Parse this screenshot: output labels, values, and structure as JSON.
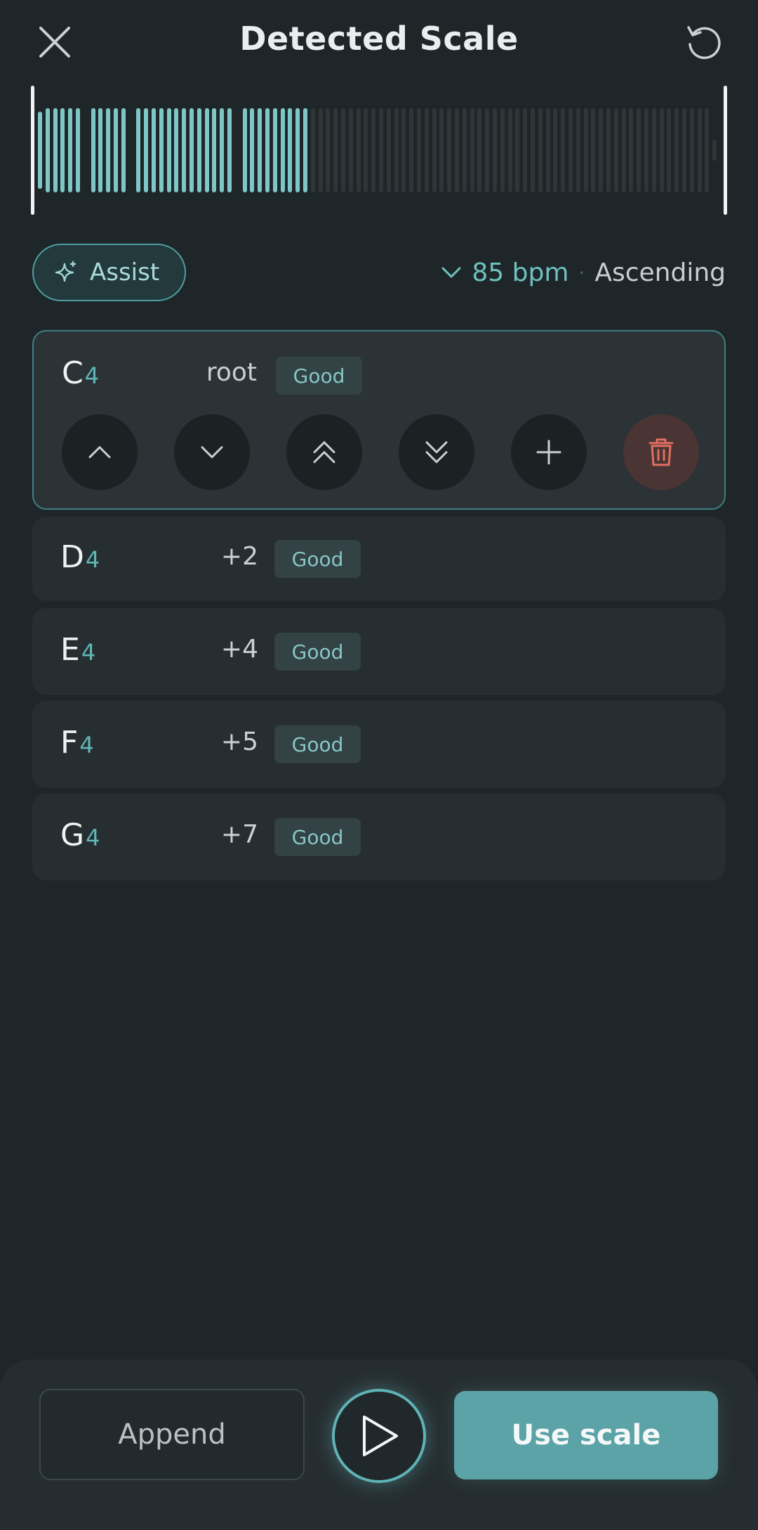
{
  "header": {
    "title": "Detected Scale",
    "close_icon": "close-icon",
    "reset_icon": "undo-icon"
  },
  "waveform": {
    "played_color": "#7fc7c7",
    "unplayed_color": "#2e3638",
    "playhead_progress": 0.4
  },
  "assist": {
    "label": "Assist",
    "icon": "sparkle-icon"
  },
  "tempo": {
    "value": "85 bpm",
    "separator": "·",
    "direction": "Ascending",
    "icon": "chevron-down-icon"
  },
  "notes": [
    {
      "name": "C",
      "octave": "4",
      "interval": "root",
      "quality": "Good"
    },
    {
      "name": "D",
      "octave": "4",
      "interval": "+2",
      "quality": "Good"
    },
    {
      "name": "E",
      "octave": "4",
      "interval": "+4",
      "quality": "Good"
    },
    {
      "name": "F",
      "octave": "4",
      "interval": "+5",
      "quality": "Good"
    },
    {
      "name": "G",
      "octave": "4",
      "interval": "+7",
      "quality": "Good"
    }
  ],
  "controls": [
    "chevron-up-icon",
    "chevron-down-icon",
    "double-chevron-up-icon",
    "double-chevron-down-icon",
    "plus-icon",
    "trash-icon"
  ],
  "footer": {
    "append_label": "Append",
    "use_label": "Use scale",
    "play_icon": "play-icon"
  },
  "colors": {
    "accent": "#5ba3a6",
    "background": "#1f2629",
    "danger": "#e0705f"
  }
}
